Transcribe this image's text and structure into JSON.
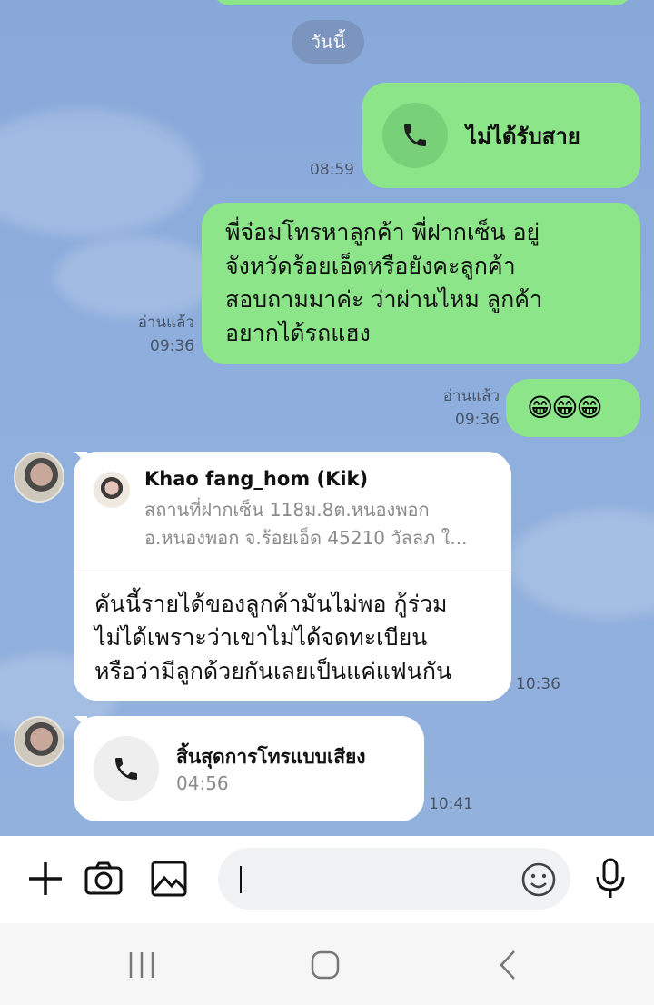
{
  "date_divider": "วันนี้",
  "messages": {
    "missed_call": {
      "label": "ไม่ได้รับสาย",
      "time": "08:59"
    },
    "outgoing_text": {
      "lines": [
        "พี่จ๋อมโทรหาลูกค้า พี่ฝากเซ็น อยู่",
        "จังหวัดร้อยเอ็ดหรือยังคะลูกค้า",
        "สอบถามมาค่ะ ว่าผ่านไหม ลูกค้า",
        "อยากได้รถแฮง"
      ],
      "read": "อ่านแล้ว",
      "time": "09:36"
    },
    "emoji": {
      "content": "😁😁😁",
      "read": "อ่านแล้ว",
      "time": "09:36"
    },
    "reply": {
      "quoted_name": "Khao fang_hom (Kik)",
      "quoted_lines": [
        "สถานที่ฝากเซ็น 118ม.8ต.หนองพอก",
        "อ.หนองพอก จ.ร้อยเอ็ด 45210 วัลลภ ใ..."
      ],
      "lines": [
        "คันนี้รายได้ของลูกค้ามันไม่พอ กู้ร่วม",
        "ไม่ได้เพราะว่าเขาไม่ได้จดทะเบียน",
        "หรือว่ามีลูกด้วยกันเลยเป็นแค่แฟนกัน"
      ],
      "time": "10:36"
    },
    "call_ended": {
      "label": "สิ้นสุดการโทรแบบเสียง",
      "duration": "04:56",
      "time": "10:41"
    }
  },
  "input": {
    "value": ""
  },
  "colors": {
    "chat_bg": "#8aa9d8",
    "outgoing": "#8de58a",
    "incoming": "#ffffff",
    "date_pill": "#7b95bf"
  },
  "icons": [
    "phone-icon",
    "plus-icon",
    "camera-icon",
    "image-icon",
    "emoji-icon",
    "mic-icon",
    "recents-icon",
    "home-icon",
    "back-icon"
  ]
}
